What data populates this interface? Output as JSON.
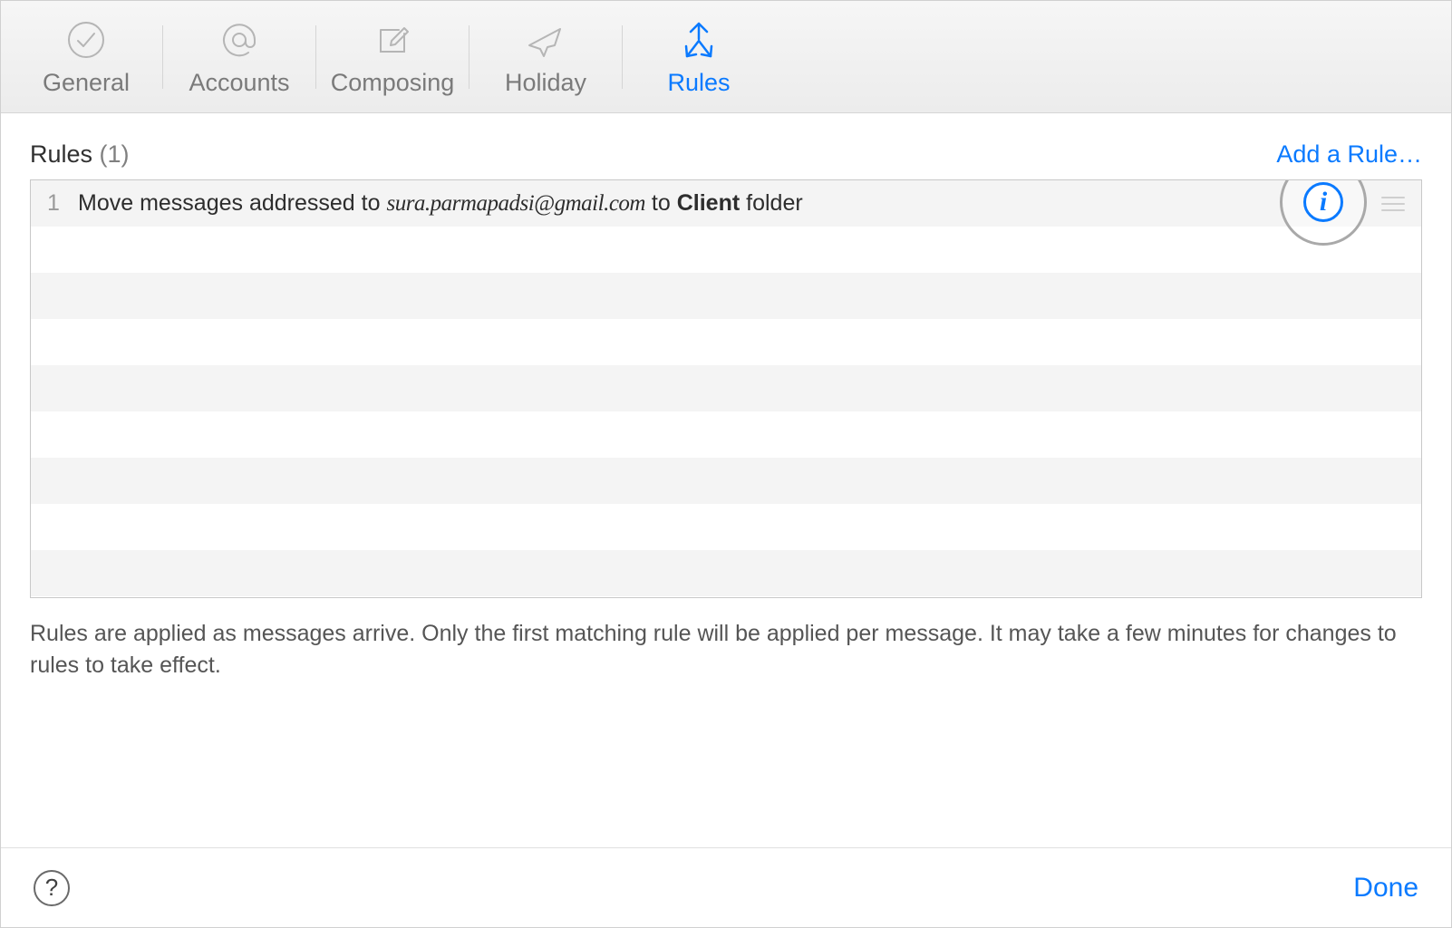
{
  "toolbar": {
    "tabs": [
      {
        "id": "general",
        "label": "General",
        "icon": "checkmark-circle-icon",
        "active": false
      },
      {
        "id": "accounts",
        "label": "Accounts",
        "icon": "at-sign-icon",
        "active": false
      },
      {
        "id": "composing",
        "label": "Composing",
        "icon": "compose-icon",
        "active": false
      },
      {
        "id": "holiday",
        "label": "Holiday",
        "icon": "airplane-icon",
        "active": false
      },
      {
        "id": "rules",
        "label": "Rules",
        "icon": "arrows-in-out-icon",
        "active": true
      }
    ]
  },
  "main": {
    "title": "Rules",
    "count_label": "(1)",
    "add_rule_label": "Add a Rule…",
    "rules": [
      {
        "index": "1",
        "prefix": "Move messages addressed to ",
        "email": "sura.parmapadsi@gmail.com",
        "middle": " to ",
        "folder": "Client",
        "suffix": " folder"
      }
    ],
    "hint": "Rules are applied as messages arrive. Only the first matching rule will be applied per message. It may take a few minutes for changes to rules to take effect."
  },
  "footer": {
    "help_tooltip": "?",
    "done_label": "Done"
  },
  "colors": {
    "accent": "#0a7aff",
    "muted": "#7a7a7a"
  }
}
